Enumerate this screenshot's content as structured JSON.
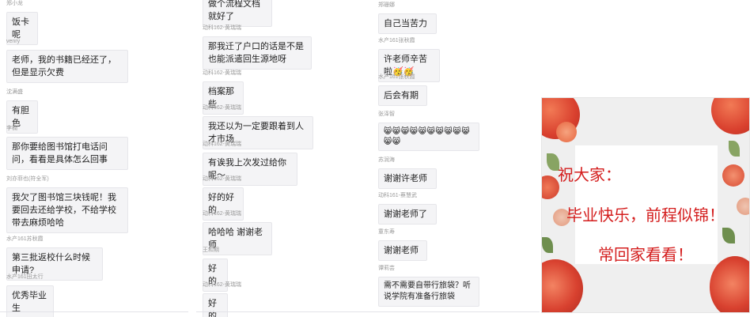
{
  "colors": {
    "bubble_bg": "#f4f4f6",
    "name_text": "#9a9a9a",
    "poster_text": "#d41e1e"
  },
  "column1": {
    "messages": [
      {
        "name": "郑小龙",
        "text": "饭卡呢"
      },
      {
        "name": "venry",
        "text": "老师，我的书籍已经还了，但是显示欠费"
      },
      {
        "name": "沈满盛",
        "text": "有胆色"
      },
      {
        "name": "李楠",
        "text": "那你要给图书馆打电话问问，看看是具体怎么回事"
      },
      {
        "name": "刘亦菲也(符全军)",
        "text": "我欠了图书馆三块钱呢！我要回去还给学校，不给学校带去麻烦哈哈"
      },
      {
        "name": "水产161苏秋霞",
        "text": "第三批返校什么时候申请?"
      },
      {
        "name": "水产161田太行",
        "text": "优秀毕业生"
      }
    ]
  },
  "column2": {
    "messages": [
      {
        "name": "",
        "text": "做个流程文档就好了"
      },
      {
        "name": "动科162-黄瑞瑞",
        "text": "那我迁了户口的话是不是也能派遣回生源地呀"
      },
      {
        "name": "动科162-黄瑞瑞",
        "text": "档案那些"
      },
      {
        "name": "动科162-黄瑞瑞",
        "text": "我还以为一定要跟着到人才市场"
      },
      {
        "name": "动科162-黄瑞瑞",
        "text": "有诶我上次发过给你呢～"
      },
      {
        "name": "动科162-黄瑞瑞",
        "text": "好的好的"
      },
      {
        "name": "动科162-黄瑞瑞",
        "text": "哈哈哈 谢谢老师"
      },
      {
        "name": "王和期",
        "text": "好的"
      },
      {
        "name": "动科162-黄瑞瑞",
        "text": "好的"
      }
    ]
  },
  "column3": {
    "messages": [
      {
        "name": "郑珊娜",
        "text": "自己当苦力"
      },
      {
        "name": "水产161张秋霞",
        "text": "许老师辛苦啦🥳🥳"
      },
      {
        "name": "水产161张秋霞",
        "text": "后会有期"
      },
      {
        "name": "张泽智",
        "text": "😸😸😸😸😸😸😸😸😸😸😸😸"
      },
      {
        "name": "苏润海",
        "text": "谢谢许老师"
      },
      {
        "name": "动科161-蔡慧武",
        "text": "谢谢老师了"
      },
      {
        "name": "童东寿",
        "text": "谢谢老师"
      },
      {
        "name": "谭莉芸",
        "text": "需不需要自带行旅袋？听说学院有准备行旅袋"
      }
    ]
  },
  "poster": {
    "line1": "祝大家：",
    "line2": "毕业快乐，前程似锦！",
    "line3": "常回家看看！"
  }
}
